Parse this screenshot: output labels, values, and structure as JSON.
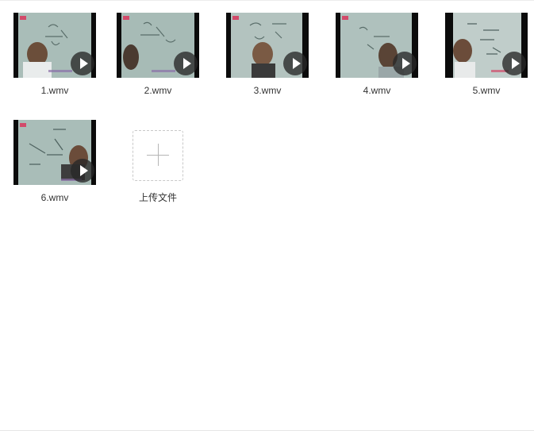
{
  "files": [
    {
      "name": "1.wmv",
      "type": "video"
    },
    {
      "name": "2.wmv",
      "type": "video"
    },
    {
      "name": "3.wmv",
      "type": "video"
    },
    {
      "name": "4.wmv",
      "type": "video"
    },
    {
      "name": "5.wmv",
      "type": "video"
    },
    {
      "name": "6.wmv",
      "type": "video"
    }
  ],
  "upload": {
    "label": "上传文件",
    "icon": "plus-icon"
  },
  "colors": {
    "background": "#ffffff",
    "text": "#333333",
    "thumbnail_board": "#a9bdb8",
    "play_overlay": "#282828"
  }
}
